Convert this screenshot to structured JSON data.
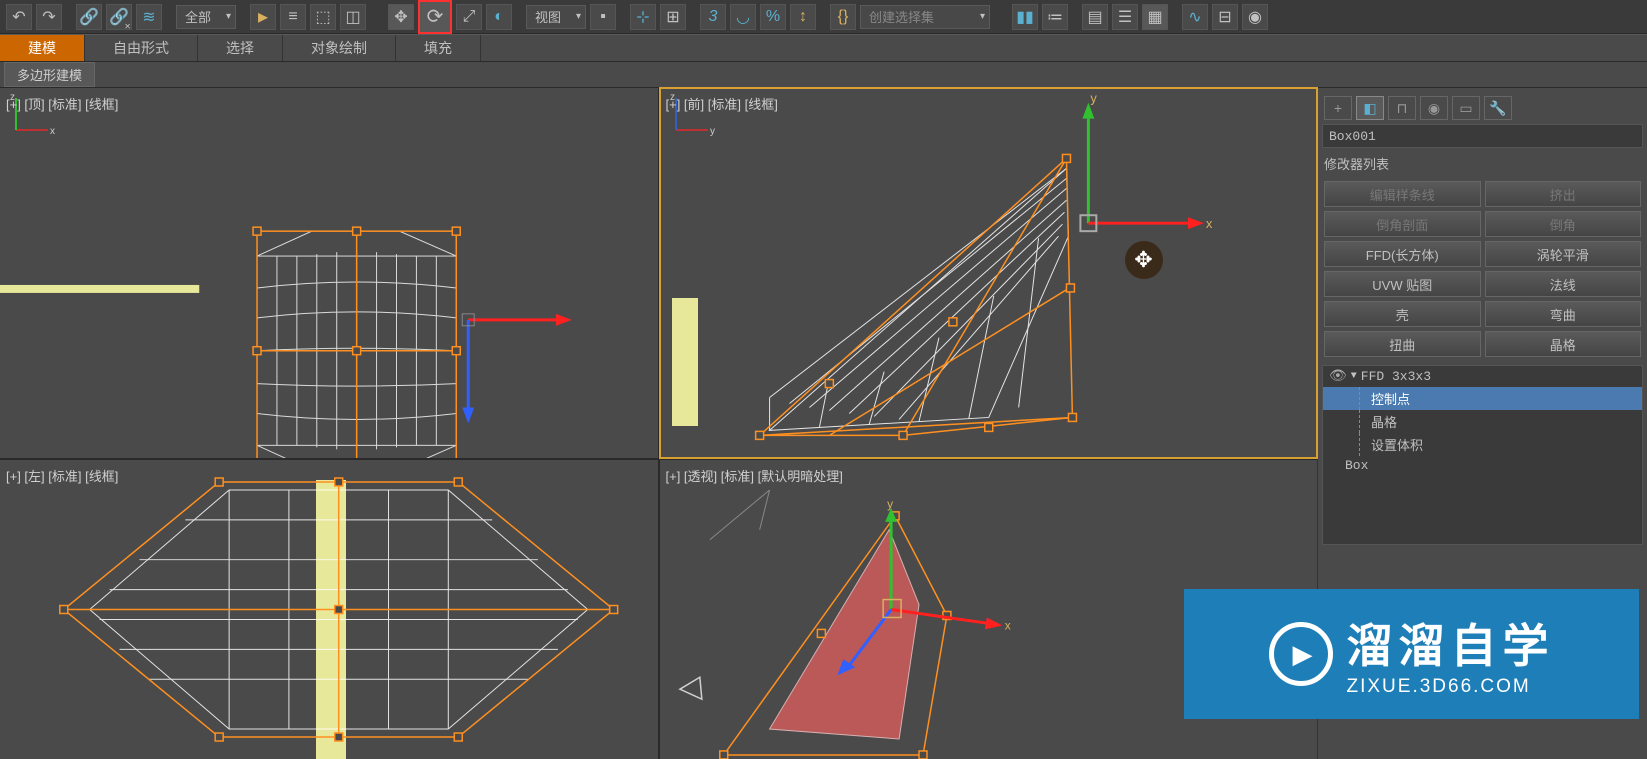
{
  "toolbar": {
    "filter_dropdown": "全部",
    "view_dropdown": "视图",
    "percent_icon": "%",
    "create_set": "创建选择集"
  },
  "ribbon": {
    "tabs": [
      "建模",
      "自由形式",
      "选择",
      "对象绘制",
      "填充"
    ],
    "subtab": "多边形建模"
  },
  "viewports": {
    "tl": "[+] [顶] [标准] [线框]",
    "tr": "[+] [前] [标准] [线框]",
    "bl": "[+] [左] [标准] [线框]",
    "br": "[+] [透视] [标准] [默认明暗处理]"
  },
  "axis": {
    "x": "x",
    "y": "y",
    "z": "z"
  },
  "panel": {
    "object_name": "Box001",
    "modifier_list_label": "修改器列表",
    "buttons": [
      "编辑样条线",
      "挤出",
      "倒角剖面",
      "倒角",
      "FFD(长方体)",
      "涡轮平滑",
      "UVW 贴图",
      "法线",
      "壳",
      "弯曲",
      "扭曲",
      "晶格"
    ],
    "disabled_indices": [
      0,
      1,
      2,
      3
    ],
    "stack": {
      "top": "FFD 3x3x3",
      "items": [
        "控制点",
        "晶格",
        "设置体积"
      ],
      "selected": 0,
      "base": "Box"
    }
  },
  "watermark": {
    "big": "溜溜自学",
    "small": "ZIXUE.3D66.COM"
  }
}
